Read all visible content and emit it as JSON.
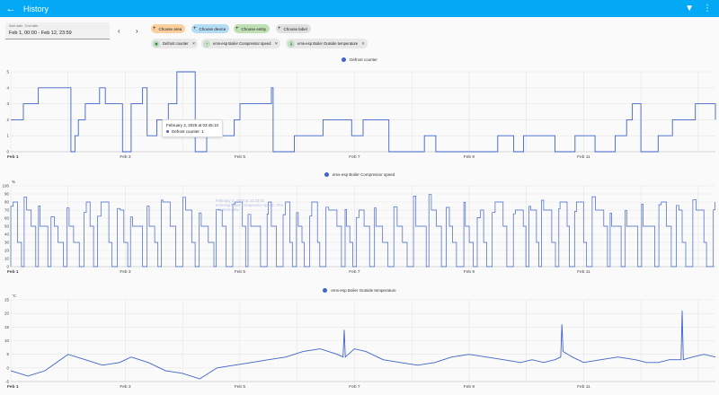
{
  "header": {
    "title": "History",
    "back_icon": "arrow-left-icon",
    "filter_icon": "filter-remove-icon",
    "menu_icon": "dots-vertical-icon"
  },
  "date_range": {
    "label": "Start date - End date",
    "value": "Feb 1, 00:00 - Feb 12, 23:59"
  },
  "target_pickers": [
    {
      "label": "Choose area",
      "color": "#fbcf9e"
    },
    {
      "label": "Choose device",
      "color": "#b3dcf5"
    },
    {
      "label": "Choose entity",
      "color": "#bfe0b4"
    },
    {
      "label": "Choose label",
      "color": "#e0e0e0"
    }
  ],
  "selected_entities": [
    {
      "label": "Defrost counter",
      "icon": "counter-icon"
    },
    {
      "label": "ems-esp Boiler Compressor speed",
      "icon": "gauge-icon"
    },
    {
      "label": "ems-esp Boiler Outside temperature",
      "icon": "thermometer-icon"
    }
  ],
  "series_color": "#3f63c8",
  "tooltips": {
    "defrost": {
      "time": "February 2, 2025 at 03:45:10",
      "value": "Defrost counter: 1"
    },
    "compressor_ghost": {
      "line1": "February 2, 2025 at 22:33:02",
      "line2": "ems-esp Boiler Compressor speed: 70%",
      "line3": "Hover to view."
    }
  },
  "chart_data": [
    {
      "type": "line",
      "title": "Defrost counter",
      "series": [
        {
          "name": "Defrost counter"
        }
      ],
      "xlabel": "",
      "ylabel": "",
      "x_ticks": [
        "Feb 1",
        "Feb 3",
        "Feb 5",
        "Feb 7",
        "Feb 9",
        "Feb 11"
      ],
      "y_ticks": [
        "0",
        "1",
        "2",
        "3",
        "4",
        "5"
      ],
      "ylim": [
        0,
        5
      ],
      "step": true,
      "x_days": [
        0,
        0.22,
        0.22,
        0.48,
        0.48,
        1.05,
        1.05,
        1.12,
        1.12,
        1.18,
        1.18,
        1.3,
        1.3,
        1.55,
        1.55,
        1.65,
        1.65,
        1.95,
        1.95,
        2.1,
        2.1,
        2.3,
        2.3,
        2.38,
        2.38,
        2.55,
        2.55,
        2.75,
        2.75,
        2.9,
        2.9,
        3.22,
        3.22,
        3.42,
        3.42,
        3.9,
        3.9,
        4.0,
        4.0,
        4.55,
        4.55,
        4.58,
        4.58,
        4.95,
        4.95,
        5.45,
        5.45,
        5.95,
        5.95,
        6.15,
        6.15,
        6.6,
        6.6,
        7.22,
        7.22,
        7.42,
        7.42,
        8.5,
        8.5,
        8.78,
        8.78,
        8.95,
        8.95,
        9.5,
        9.5,
        9.85,
        9.85,
        10.2,
        10.2,
        10.55,
        10.55,
        10.75,
        10.75,
        10.85,
        10.85,
        11.0,
        11.0,
        11.3,
        11.3,
        11.55,
        11.55,
        11.95,
        11.95,
        12.3,
        12.3,
        12.3
      ],
      "values": [
        2,
        2,
        3,
        3,
        4,
        4,
        0,
        0,
        1,
        1,
        2,
        2,
        3,
        3,
        4,
        4,
        3,
        3,
        0,
        0,
        3,
        3,
        4,
        4,
        1,
        1,
        2,
        2,
        3,
        3,
        5,
        5,
        0,
        0,
        1,
        1,
        2,
        2,
        3,
        3,
        4,
        4,
        0,
        0,
        1,
        1,
        2,
        2,
        1,
        1,
        2,
        2,
        0,
        0,
        1,
        1,
        0,
        0,
        1,
        1,
        0,
        0,
        1,
        1,
        0,
        0,
        1,
        1,
        0,
        0,
        1,
        1,
        2,
        2,
        3,
        3,
        0,
        0,
        1,
        1,
        2,
        2,
        3,
        3,
        2,
        2,
        1,
        1,
        0,
        0,
        1,
        1,
        2,
        2
      ]
    },
    {
      "type": "line",
      "title": "ems-esp Boiler Compressor speed",
      "series": [
        {
          "name": "ems-esp Boiler Compressor speed"
        }
      ],
      "xlabel": "",
      "ylabel": "%",
      "x_ticks": [
        "Feb 1",
        "Feb 3",
        "Feb 5",
        "Feb 7",
        "Feb 9",
        "Feb 11"
      ],
      "y_ticks": [
        "0",
        "10",
        "20",
        "30",
        "40",
        "50",
        "60",
        "70",
        "80",
        "90",
        "100"
      ],
      "ylim": [
        0,
        100
      ],
      "pattern": "frequent 0-90% cycling with plateaus near 80, 70, 50, 30 and 0"
    },
    {
      "type": "line",
      "title": "ems-esp Boiler Outside temperature",
      "series": [
        {
          "name": "ems-esp Boiler Outside temperature"
        }
      ],
      "xlabel": "",
      "ylabel": "°C",
      "x_ticks": [
        "Feb 1",
        "Feb 3",
        "Feb 5",
        "Feb 7",
        "Feb 9",
        "Feb 11"
      ],
      "y_ticks": [
        "-5",
        "0",
        "5",
        "10",
        "15",
        "20",
        "25"
      ],
      "ylim": [
        -5,
        25
      ],
      "x_days": [
        0,
        0.3,
        0.6,
        0.8,
        1.0,
        1.3,
        1.6,
        1.9,
        2.1,
        2.4,
        2.7,
        3.0,
        3.3,
        3.6,
        3.9,
        4.2,
        4.5,
        4.8,
        5.1,
        5.4,
        5.7,
        5.8,
        5.82,
        5.84,
        6.0,
        6.2,
        6.5,
        6.8,
        7.1,
        7.4,
        7.7,
        8.0,
        8.3,
        8.6,
        8.9,
        9.1,
        9.3,
        9.5,
        9.6,
        9.62,
        9.64,
        9.8,
        10.0,
        10.3,
        10.6,
        10.9,
        11.1,
        11.3,
        11.5,
        11.7,
        11.72,
        11.74,
        11.9,
        12.1,
        12.3
      ],
      "values": [
        -1,
        -3,
        -1,
        2,
        5,
        3,
        1,
        2,
        4,
        2,
        -1,
        -2,
        -4,
        0,
        1,
        2,
        3,
        4,
        6,
        7,
        5,
        4,
        14,
        4,
        7,
        6,
        3,
        2,
        1,
        2,
        4,
        5,
        4,
        3,
        2,
        3,
        2,
        3,
        4,
        16,
        6,
        4,
        2,
        3,
        4,
        3,
        2,
        2,
        3,
        3,
        21,
        3,
        4,
        5,
        4
      ]
    }
  ]
}
